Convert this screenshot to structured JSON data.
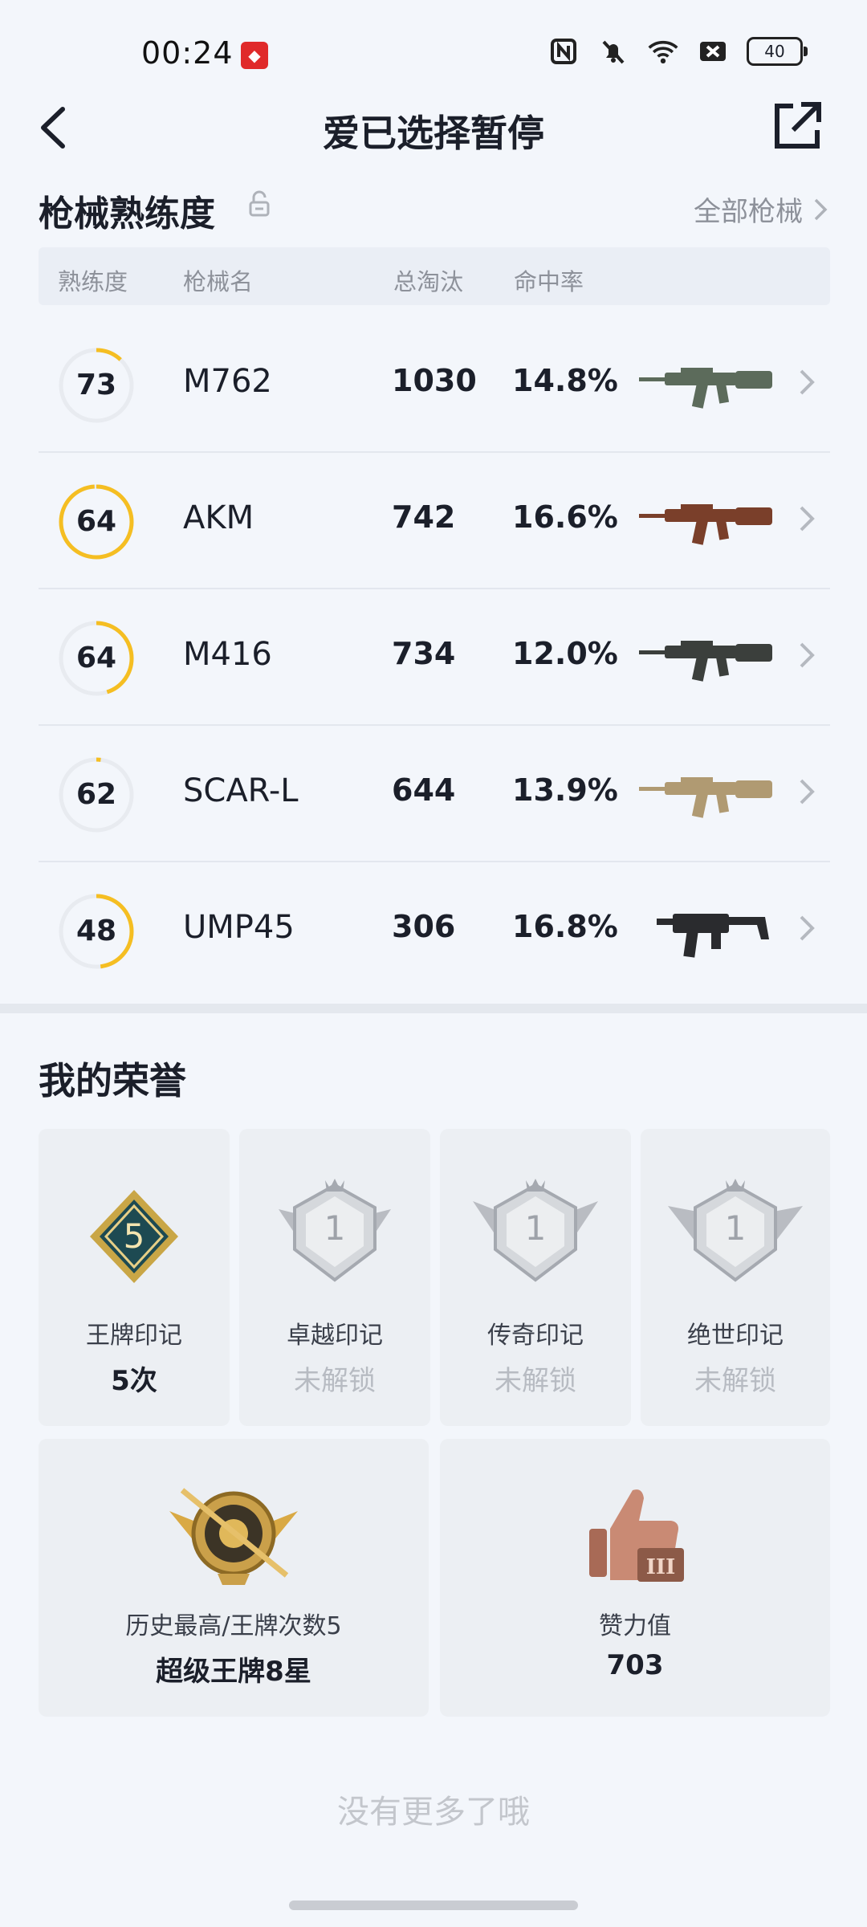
{
  "status": {
    "time": "00:24",
    "battery": "40",
    "app_icon": "app-notification-icon"
  },
  "nav": {
    "title": "爱已选择暂停"
  },
  "weapons": {
    "section_title": "枪械熟练度",
    "all_label": "全部枪械",
    "columns": [
      "熟练度",
      "枪械名",
      "总淘汰",
      "命中率"
    ],
    "rows": [
      {
        "proficiency": "73",
        "progress": 0.12,
        "name": "M762",
        "kills": "1030",
        "hit_rate": "14.8%",
        "gun_color": "#5c6b5b"
      },
      {
        "proficiency": "64",
        "progress": 0.99,
        "name": "AKM",
        "kills": "742",
        "hit_rate": "16.6%",
        "gun_color": "#7a3f2a"
      },
      {
        "proficiency": "64",
        "progress": 0.45,
        "name": "M416",
        "kills": "734",
        "hit_rate": "12.0%",
        "gun_color": "#3b3f3c"
      },
      {
        "proficiency": "62",
        "progress": 0.02,
        "name": "SCAR-L",
        "kills": "644",
        "hit_rate": "13.9%",
        "gun_color": "#b09a72"
      },
      {
        "proficiency": "48",
        "progress": 0.48,
        "name": "UMP45",
        "kills": "306",
        "hit_rate": "16.8%",
        "gun_color": "#2a2b2e"
      }
    ]
  },
  "honor": {
    "section_title": "我的荣誉",
    "marks": [
      {
        "label": "王牌印记",
        "value": "5次",
        "locked": false,
        "badge_num": "5"
      },
      {
        "label": "卓越印记",
        "value": "未解锁",
        "locked": true,
        "badge_num": "1"
      },
      {
        "label": "传奇印记",
        "value": "未解锁",
        "locked": true,
        "badge_num": "1"
      },
      {
        "label": "绝世印记",
        "value": "未解锁",
        "locked": true,
        "badge_num": "1"
      }
    ],
    "best": {
      "label": "历史最高/王牌次数5",
      "value": "超级王牌8星"
    },
    "likes": {
      "label": "赞力值",
      "value": "703",
      "badge_text": "III"
    }
  },
  "footer": {
    "text": "没有更多了哦"
  },
  "colors": {
    "accent": "#f5be22",
    "ring_track": "#e8ebf0",
    "muted": "#8d919a"
  }
}
